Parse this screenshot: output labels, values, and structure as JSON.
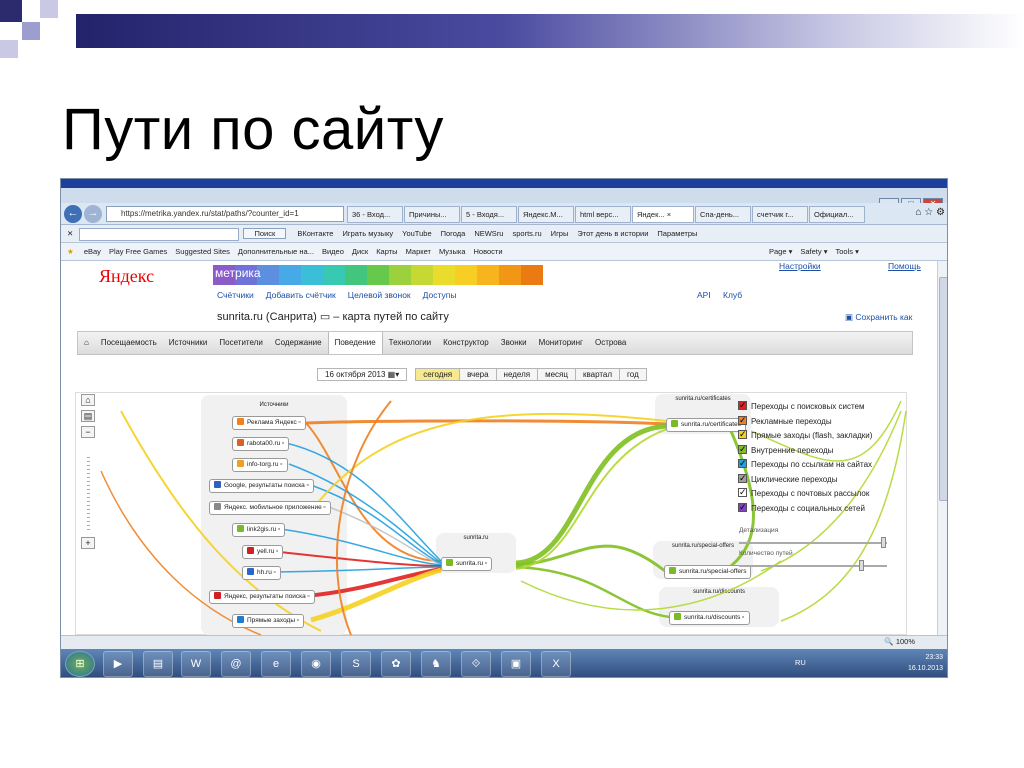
{
  "slide": {
    "title": "Пути по сайту"
  },
  "browser": {
    "address": "https://metrika.yandex.ru/stat/paths/?counter_id=1",
    "tabs": [
      "36 - Вход...",
      "Причины...",
      "5 - Входя...",
      "Яндекс.М...",
      "html верс...",
      "Яндек... ×",
      "Спа-день...",
      "счетчик г...",
      "Официал..."
    ],
    "search_button": "Поиск",
    "cmd_items": [
      "ВКонтакте",
      "Играть музыку",
      "YouTube",
      "Погода",
      "NEWSru",
      "sports.ru",
      "Игры",
      "Этот день в истории",
      "Параметры"
    ],
    "fav_items": [
      "eBay",
      "Play Free Games",
      "Suggested Sites",
      "Дополнительные на...",
      "Видео",
      "Диск",
      "Карты",
      "Маркет",
      "Музыка",
      "Новости"
    ],
    "ie_menu": [
      "Page",
      "Safety",
      "Tools"
    ],
    "zoom": "100%"
  },
  "page": {
    "logo": "Яндекс",
    "product": "метрика",
    "corner_links": [
      "Настройки",
      "Помощь"
    ],
    "top_links": [
      "Счётчики",
      "Добавить счётчик",
      "Целевой звонок",
      "Доступы"
    ],
    "right_links": [
      "API",
      "Клуб"
    ],
    "title": "sunrita.ru (Санрита) ▭ – карта путей по сайту",
    "save_link": "Сохранить как",
    "menu": [
      "Посещаемость",
      "Источники",
      "Посетители",
      "Содержание",
      "Поведение",
      "Технологии",
      "Конструктор",
      "Звонки",
      "Мониторинг",
      "Острова"
    ],
    "active_menu": "Поведение",
    "date": "16 октября 2013",
    "periods": [
      "сегодня",
      "вчера",
      "неделя",
      "месяц",
      "квартал",
      "год"
    ],
    "active_period": "сегодня"
  },
  "map": {
    "sources_header": "Источники",
    "sources": [
      "Реклама Яндекс",
      "rabota00.ru",
      "info-torg.ru",
      "Google, результаты поиска",
      "Яндекс. мобильное приложение",
      "link2gis.ru",
      "yell.ru",
      "hh.ru",
      "Яндекс, результаты поиска",
      "Прямые заходы"
    ],
    "center_zone": "sunrita.ru",
    "center_node": "sunrita.ru",
    "zones": [
      "sunrita.ru/certificates",
      "sunrita.ru/special-offers",
      "sunrita.ru/discounts"
    ],
    "zone_nodes": [
      "sunrita.ru/certificates",
      "sunrita.ru/special-offers",
      "sunrita.ru/discounts"
    ]
  },
  "legend": {
    "items": [
      {
        "label": "Переходы с поисковых систем",
        "color": "#e02020"
      },
      {
        "label": "Рекламные переходы",
        "color": "#f08020"
      },
      {
        "label": "Прямые заходы (flash, закладки)",
        "color": "#f5d020"
      },
      {
        "label": "Внутренние переходы",
        "color": "#80c020"
      },
      {
        "label": "Переходы по ссылкам на сайтах",
        "color": "#20a0e0"
      },
      {
        "label": "Циклические переходы",
        "color": "#a0a0a0"
      },
      {
        "label": "Переходы с почтовых рассылок",
        "color": "#ffffff"
      },
      {
        "label": "Переходы с социальных сетей",
        "color": "#8040c0"
      }
    ],
    "detail_label": "Детализация",
    "count_label": "Количество путей"
  },
  "taskbar": {
    "lang": "RU",
    "time": "23:33",
    "date": "16.10.2013"
  }
}
